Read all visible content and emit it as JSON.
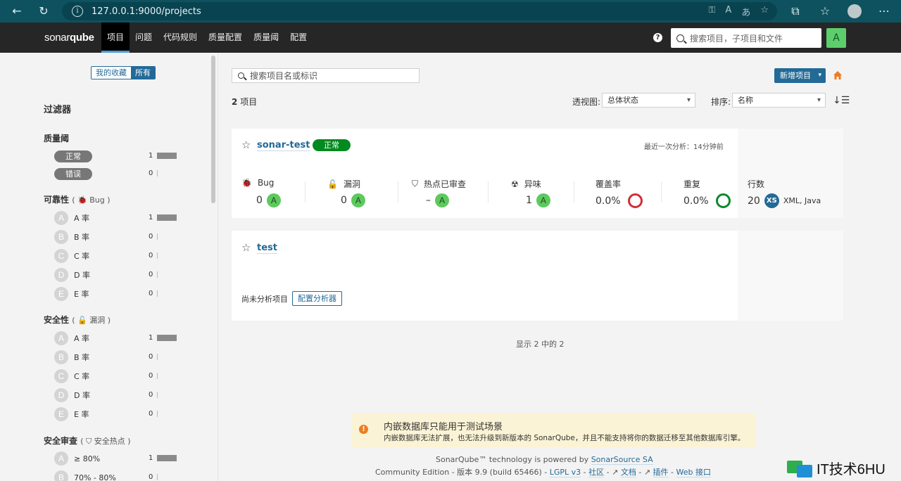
{
  "browser": {
    "url": "127.0.0.1:9000/projects"
  },
  "nav": {
    "logo_light": "sonar",
    "logo_bold": "qube",
    "items": [
      "项目",
      "问题",
      "代码规则",
      "质量配置",
      "质量阈",
      "配置"
    ],
    "search_placeholder": "搜索项目，子项目和文件",
    "avatar": "A"
  },
  "sidebar": {
    "fav_mine": "我的收藏",
    "fav_all": "所有",
    "filters_title": "过滤器",
    "quality_gate": {
      "title": "质量阈",
      "items": [
        {
          "label": "正常",
          "count": "1",
          "fraction": 1
        },
        {
          "label": "错误",
          "count": "0",
          "fraction": 0
        }
      ]
    },
    "reliability": {
      "title": "可靠性",
      "sub": "Bug",
      "items": [
        {
          "grade": "A",
          "label": "A 率",
          "count": "1",
          "fraction": 1
        },
        {
          "grade": "B",
          "label": "B 率",
          "count": "0",
          "fraction": 0
        },
        {
          "grade": "C",
          "label": "C 率",
          "count": "0",
          "fraction": 0
        },
        {
          "grade": "D",
          "label": "D 率",
          "count": "0",
          "fraction": 0
        },
        {
          "grade": "E",
          "label": "E 率",
          "count": "0",
          "fraction": 0
        }
      ]
    },
    "security": {
      "title": "安全性",
      "sub": "漏洞",
      "items": [
        {
          "grade": "A",
          "label": "A 率",
          "count": "1",
          "fraction": 1
        },
        {
          "grade": "B",
          "label": "B 率",
          "count": "0",
          "fraction": 0
        },
        {
          "grade": "C",
          "label": "C 率",
          "count": "0",
          "fraction": 0
        },
        {
          "grade": "D",
          "label": "D 率",
          "count": "0",
          "fraction": 0
        },
        {
          "grade": "E",
          "label": "E 率",
          "count": "0",
          "fraction": 0
        }
      ]
    },
    "review": {
      "title": "安全审查",
      "sub": "安全热点",
      "items": [
        {
          "grade": "A",
          "label": "≥ 80%",
          "count": "1",
          "fraction": 1
        },
        {
          "grade": "B",
          "label": "70% - 80%",
          "count": "0",
          "fraction": 0
        }
      ]
    }
  },
  "main": {
    "search_placeholder": "搜索项目名或标识",
    "new_project": "新增项目",
    "count_num": "2",
    "count_unit": "项目",
    "perspective_label": "透视图:",
    "perspective_value": "总体状态",
    "sort_label": "排序:",
    "sort_value": "名称",
    "projects": [
      {
        "name": "sonar-test",
        "status": "正常",
        "last_analysis": "最近一次分析：14分钟前",
        "measures": {
          "bug_label": "Bug",
          "bug_value": "0",
          "bug_rating": "A",
          "vuln_label": "漏洞",
          "vuln_value": "0",
          "vuln_rating": "A",
          "hotspot_label": "热点已审查",
          "hotspot_value": "–",
          "hotspot_rating": "A",
          "smell_label": "异味",
          "smell_value": "1",
          "smell_rating": "A",
          "coverage_label": "覆盖率",
          "coverage_value": "0.0%",
          "dup_label": "重复",
          "dup_value": "0.0%",
          "lines_label": "行数",
          "lines_value": "20",
          "size": "XS",
          "langs": "XML, Java"
        }
      },
      {
        "name": "test",
        "not_analyzed": "尚未分析项目",
        "config_button": "配置分析器"
      }
    ],
    "pagination": "显示 2 中的 2"
  },
  "footer": {
    "warn_title": "内嵌数据库只能用于测试场景",
    "warn_text": "内嵌数据库无法扩展，也无法升级到新版本的 SonarQube，并且不能支持将你的数据迁移至其他数据库引擎。",
    "powered_prefix": "SonarQube™ technology is powered by ",
    "powered_link": "SonarSource SA",
    "edition": "Community Edition - 版本 9.9 (build 65466) - ",
    "lgpl": "LGPL v3",
    "community": "社区",
    "docs": "文档",
    "plugins": "插件",
    "web_api": "Web 接口"
  },
  "watermark": "IT技术6HU",
  "colors": {
    "accent": "#236a97",
    "pass": "#008a1f",
    "rating_a": "#5ec95e"
  }
}
